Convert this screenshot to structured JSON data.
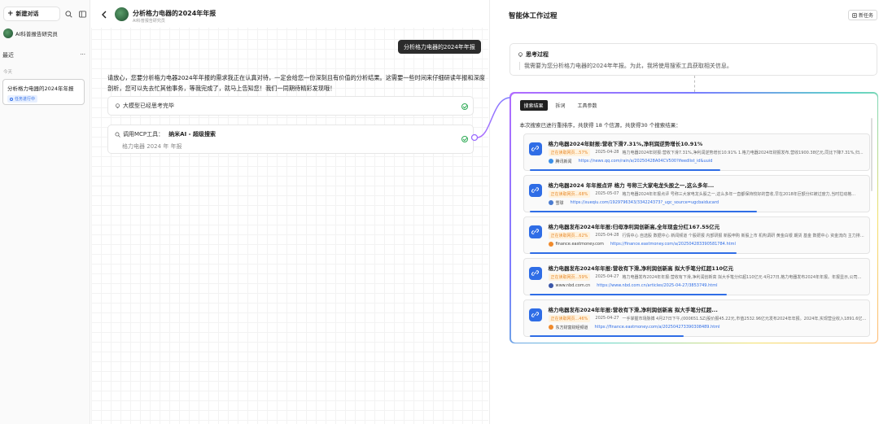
{
  "sidebar": {
    "new_chat_label": "新建对话",
    "agent_name": "AI科普报告研究员",
    "recent_label": "最近",
    "more_label": "···",
    "today_label": "今天",
    "conversation": {
      "title": "分析格力电器的2024年年报",
      "status": "任务进行中"
    }
  },
  "chat": {
    "title": "分析格力电器的2024年年报",
    "subtitle": "AI科普报告研究员",
    "user_message": "分析格力电器的2024年年报",
    "reply": "请放心，您要分析格力电器2024年年报的需求我正在认真对待，一定会给您一份深刻且有价值的分析结果。这需要一些时间来仔细研读年报和深度剖析，您可以先去忙其他事务，等我完成了，就马上告知您！我们一同期待精彩发现哦！",
    "status1": "大模型已经思考完毕",
    "status2_prefix": "调用MCP工具：",
    "status2_tool": "纳米AI - 超级搜索",
    "status2_query": "格力电器 2024 年 年报"
  },
  "panel": {
    "title": "智能体工作过程",
    "new_task_label": "新任务",
    "thinking_title": "思考过程",
    "thinking_text": "我需要为您分析格力电器的2024年年报。为此，我将使用搜索工具获取相关信息。",
    "tabs": [
      "搜索结果",
      "拆词",
      "工具参数"
    ],
    "summary": "本次搜索已进行重排序，共获得 18 个信源，共获得30 个搜索结果：",
    "results": [
      {
        "title": "格力电器2024年财报:营收下滑7.31%,净利润逆势增长10.91%",
        "relevance": "正在读取网页...57%",
        "date": "2025-04-28",
        "snippet": "格力电器2024年财报:营收下滑7.31%,净利润逆势增长10.91% 1.格力电器2024年财报发布,营收1900.38亿元,同比下降7.31%,归...",
        "source": "腾讯新闻",
        "url": "https://news.qq.com/rain/a/20250428A04CV500?ifeedlist_id&uuid",
        "progress": 0.57,
        "src_color": "#3a8fe8"
      },
      {
        "title": "格力电器2024 年年报点评 格力 号称三大家电龙头股之一,这么多年...",
        "relevance": "正在读取网页...68%",
        "date": "2025-05-07",
        "snippet": "格力电器2024年年报点评 号称三大家电龙头股之一,这么多年一直都保持较好的营收,早在2018年巨额分红被过度力,当时拉动格...",
        "source": "雪球",
        "url": "https://xueqiu.com/1929796343/334224373?_ugc_source=ugcbaiducard",
        "progress": 0.68,
        "src_color": "#4a7bd0"
      },
      {
        "title": "格力电器发布2024年年报:归母净利润创新高,全年现金分红167.55亿元",
        "relevance": "正在读取网页...62%",
        "date": "2025-04-28",
        "snippet": "行情中心 自选股 数据中心 新闻频道 个股研报 内部研报 新股申购 新股上市 机构调研 黄金白银 期货 基金 数据中心 资金流向 主力排名 板块资金 ...",
        "source": "finance.eastmoney.com",
        "url": "https://finance.eastmoney.com/a/202504283390581784.html",
        "progress": 0.62,
        "src_color": "#f08a2c"
      },
      {
        "title": "格力电器发布2024年年报:营收有下滑,净利润创新高 拟大手笔分红超110亿元",
        "relevance": "正在读取网页...59%",
        "date": "2025-04-27",
        "snippet": "格力电器发布2024年年报:营收有下滑,净利润创新高 拟大手笔分红超110亿元 4月27日,格力电器发布2024年年报。年报显示,公司...",
        "source": "www.nbd.com.cn",
        "url": "https://www.nbd.com.cn/articles/2025-04-27/3853749.html",
        "progress": 0.59,
        "src_color": "#3a56a8"
      },
      {
        "title": "格力电器发布2024年年报:营收有下滑,净利润创新高 拟大手笔分红超...",
        "relevance": "正在读取网页...46%",
        "date": "2025-04-27",
        "snippet": "一手掌握市场脉搏 4月27日下午,(000651.SZ)股价报45.22元,市值2532.96亿元发布2024年年报。2024年,实现营业收入1891.6亿元...",
        "source": "东方财富财经频道",
        "url": "https://finance.eastmoney.com/a/202504273390308489.html",
        "progress": 0.46,
        "src_color": "#f08a2c"
      }
    ]
  }
}
